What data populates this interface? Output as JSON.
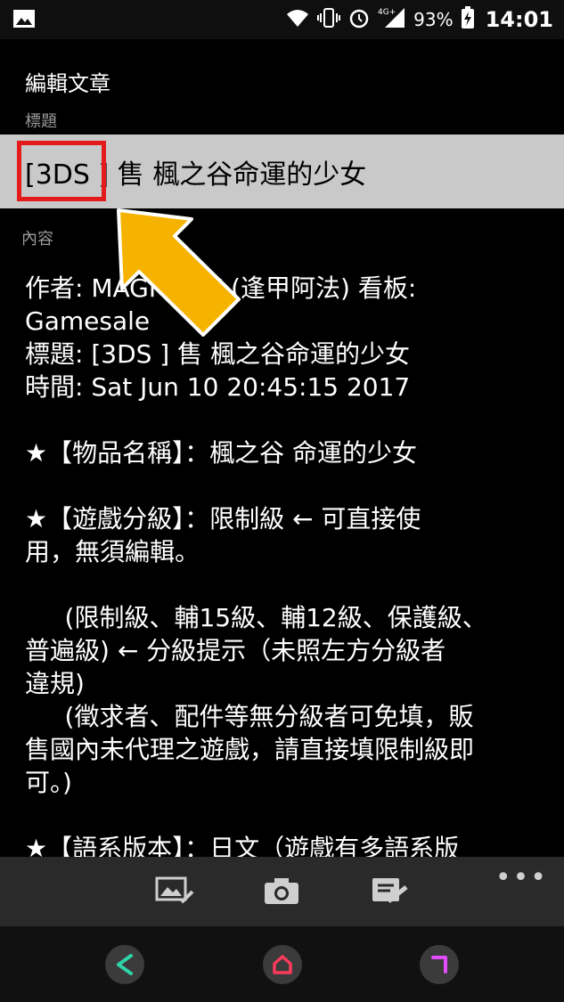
{
  "status_bar": {
    "battery_percent": "93%",
    "time": "14:01",
    "network": "4G+"
  },
  "editor": {
    "heading": "編輯文章",
    "title_label": "標題",
    "title_value": "[3DS ] 售 楓之谷命運的少女",
    "content_label": "內容",
    "content_text": "作者: MAGICFOX (逢甲阿法) 看板:\nGamesale\n標題: [3DS ] 售 楓之谷命運的少女\n時間: Sat Jun 10 20:45:15 2017\n\n★【物品名稱】：楓之谷 命運的少女\n\n★【遊戲分級】：限制級 ← 可直接使\n用，無須編輯。\n\n     (限制級、輔15級、輔12級、保護級、\n普遍級) ← 分級提示（未照左方分級者\n違規)\n     (徵求者、配件等無分級者可免填，販\n售國內未代理之遊戲，請直接填限制級即\n可。)\n\n★【語系版本】：日文（遊戲有多語系版"
  },
  "toolbar": {
    "icons": [
      "image-attach-icon",
      "camera-icon",
      "draft-send-icon"
    ],
    "more_label": "•••"
  },
  "nav": {
    "icons": [
      "back-icon",
      "home-icon",
      "recent-apps-icon"
    ]
  },
  "colors": {
    "highlight_box": "#e31b1b",
    "arrow": "#f5b300",
    "title_field_bg": "#c9c9c9"
  }
}
